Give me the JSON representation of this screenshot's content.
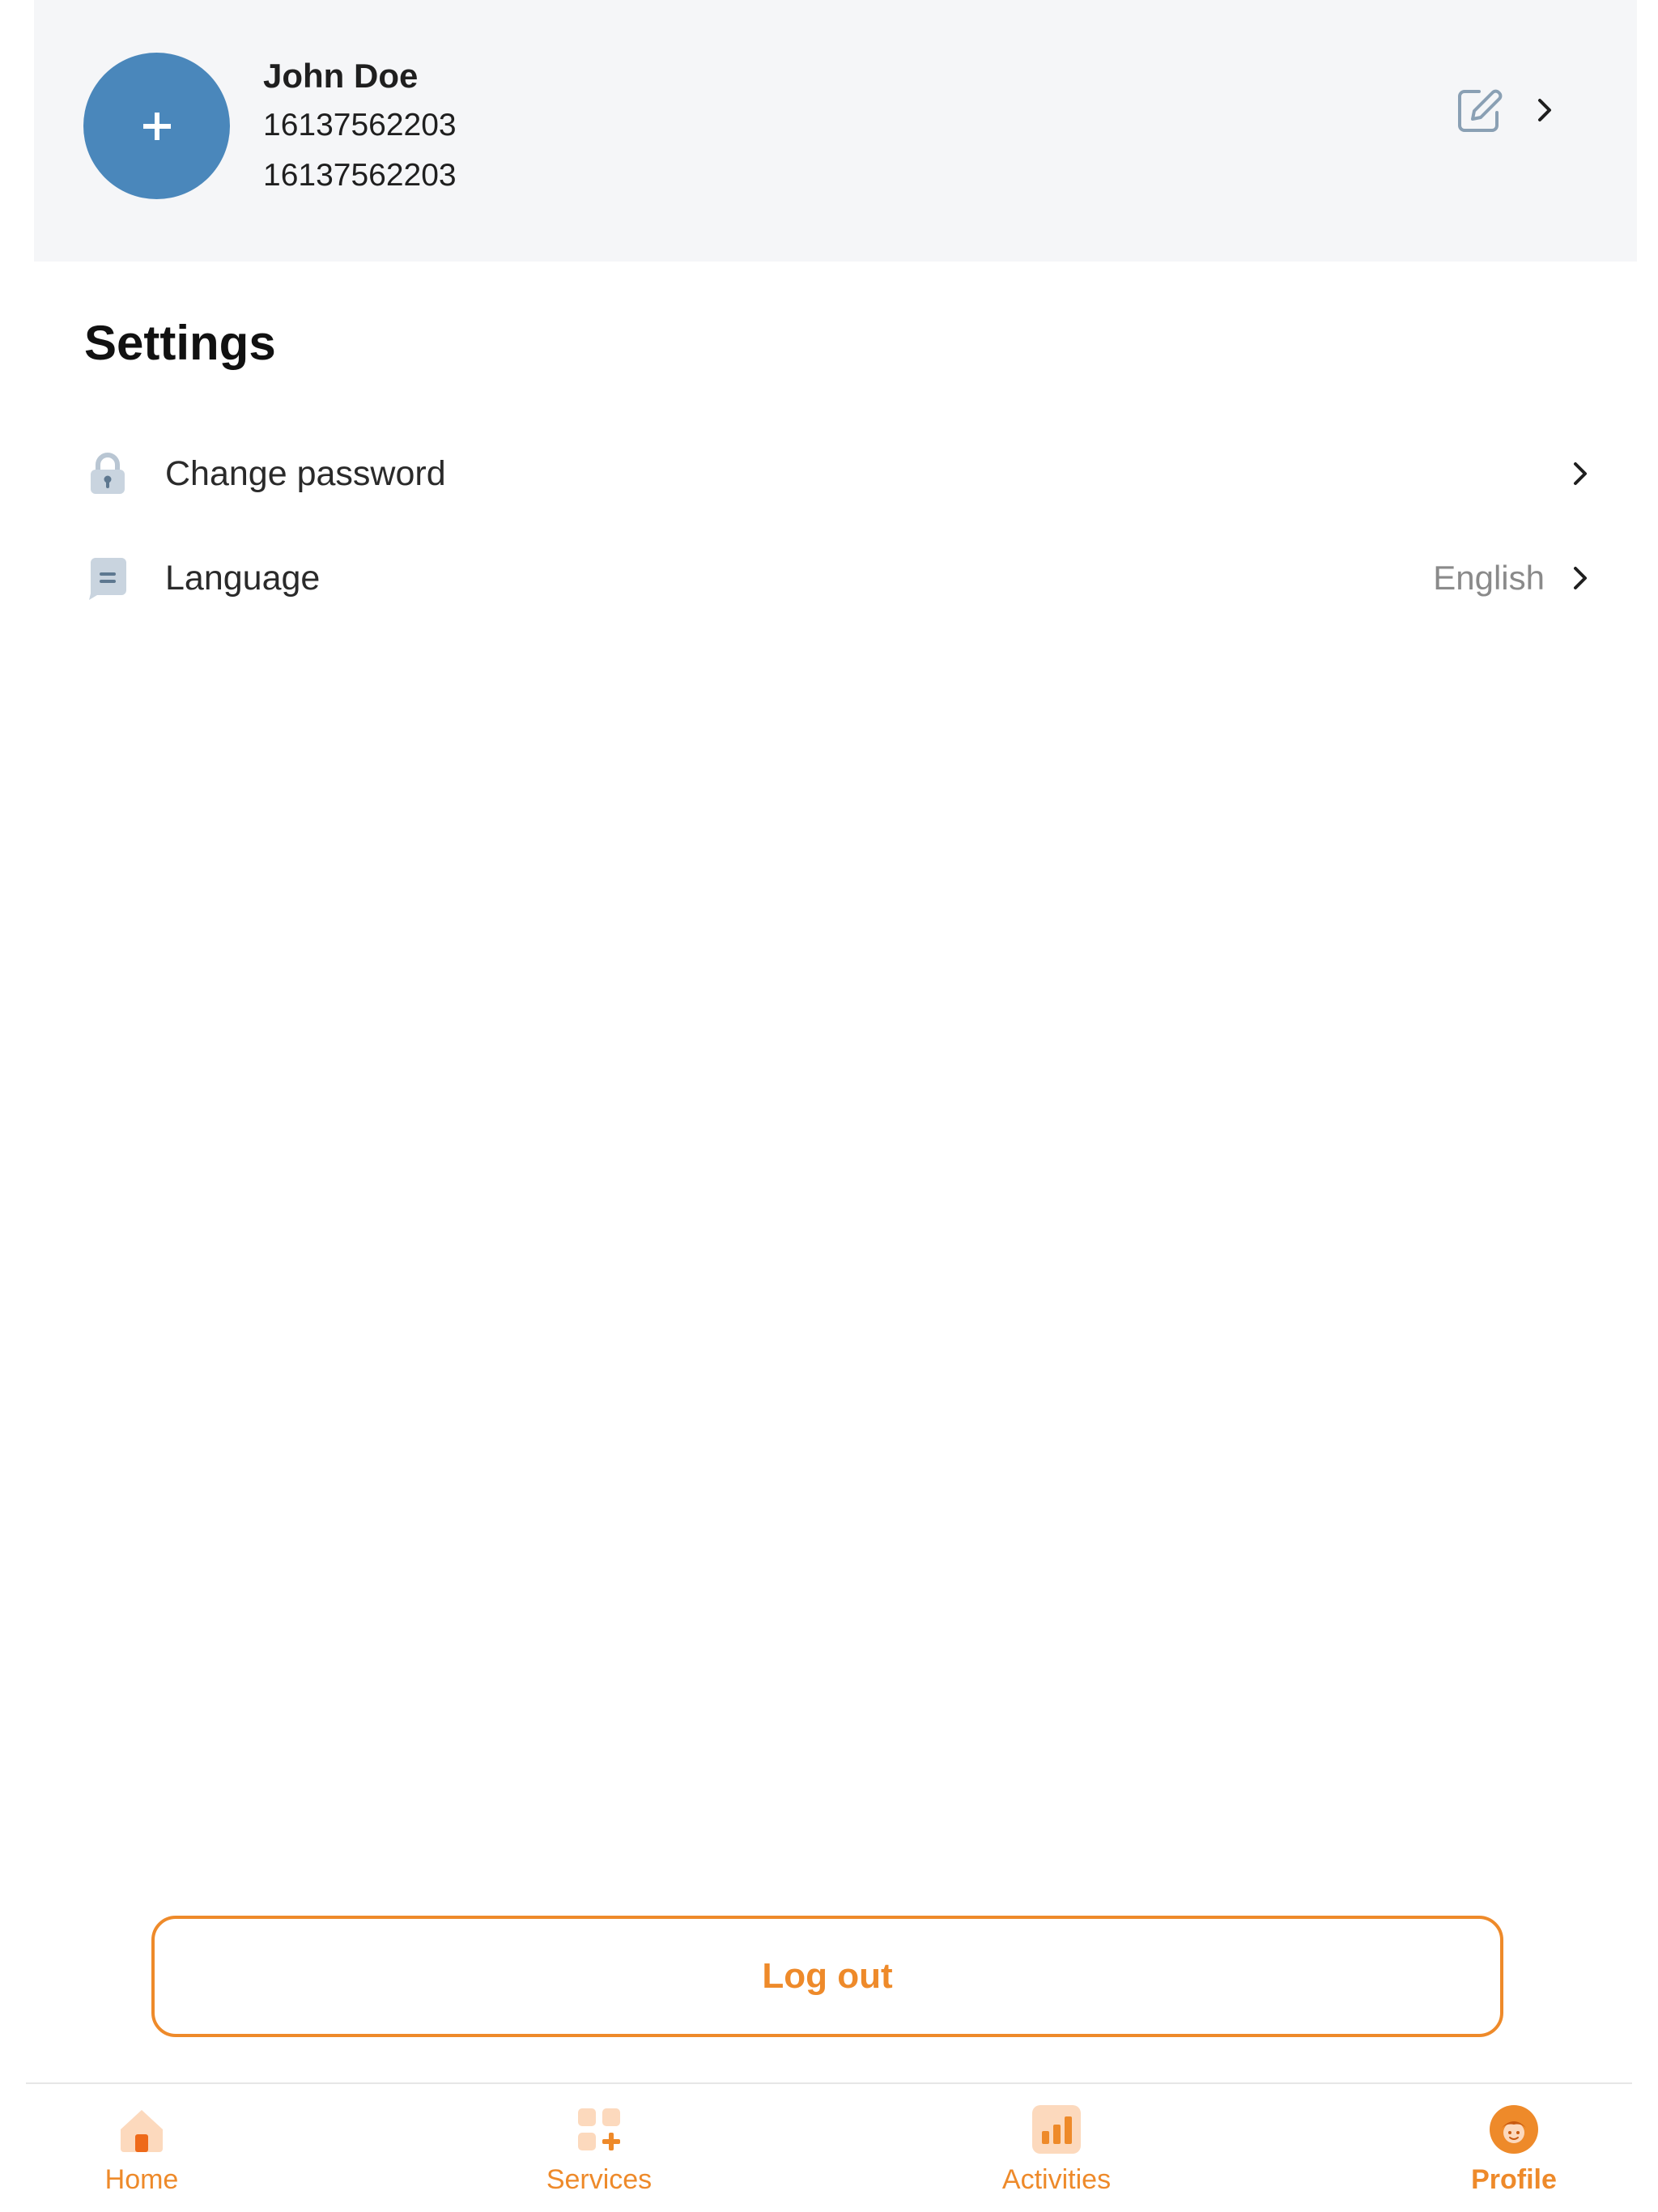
{
  "profile": {
    "name": "John Doe",
    "phone": "16137562203",
    "id": "16137562203",
    "avatar_icon": "plus-icon",
    "edit_icon": "edit-icon",
    "chevron_icon": "chevron-right-icon"
  },
  "settings": {
    "title": "Settings",
    "items": [
      {
        "label": "Change password",
        "icon": "lock-icon",
        "value": ""
      },
      {
        "label": "Language",
        "icon": "language-icon",
        "value": "English"
      }
    ]
  },
  "logout": {
    "label": "Log out"
  },
  "bottom_nav": {
    "items": [
      {
        "label": "Home",
        "icon": "home-icon",
        "active": false
      },
      {
        "label": "Services",
        "icon": "services-icon",
        "active": false
      },
      {
        "label": "Activities",
        "icon": "activities-icon",
        "active": false
      },
      {
        "label": "Profile",
        "icon": "profile-icon",
        "active": true
      }
    ]
  },
  "colors": {
    "accent": "#ee8a2a",
    "avatar": "#4a87bb",
    "header_bg": "#f5f6f8",
    "icon_gray": "#8aa0b4"
  }
}
